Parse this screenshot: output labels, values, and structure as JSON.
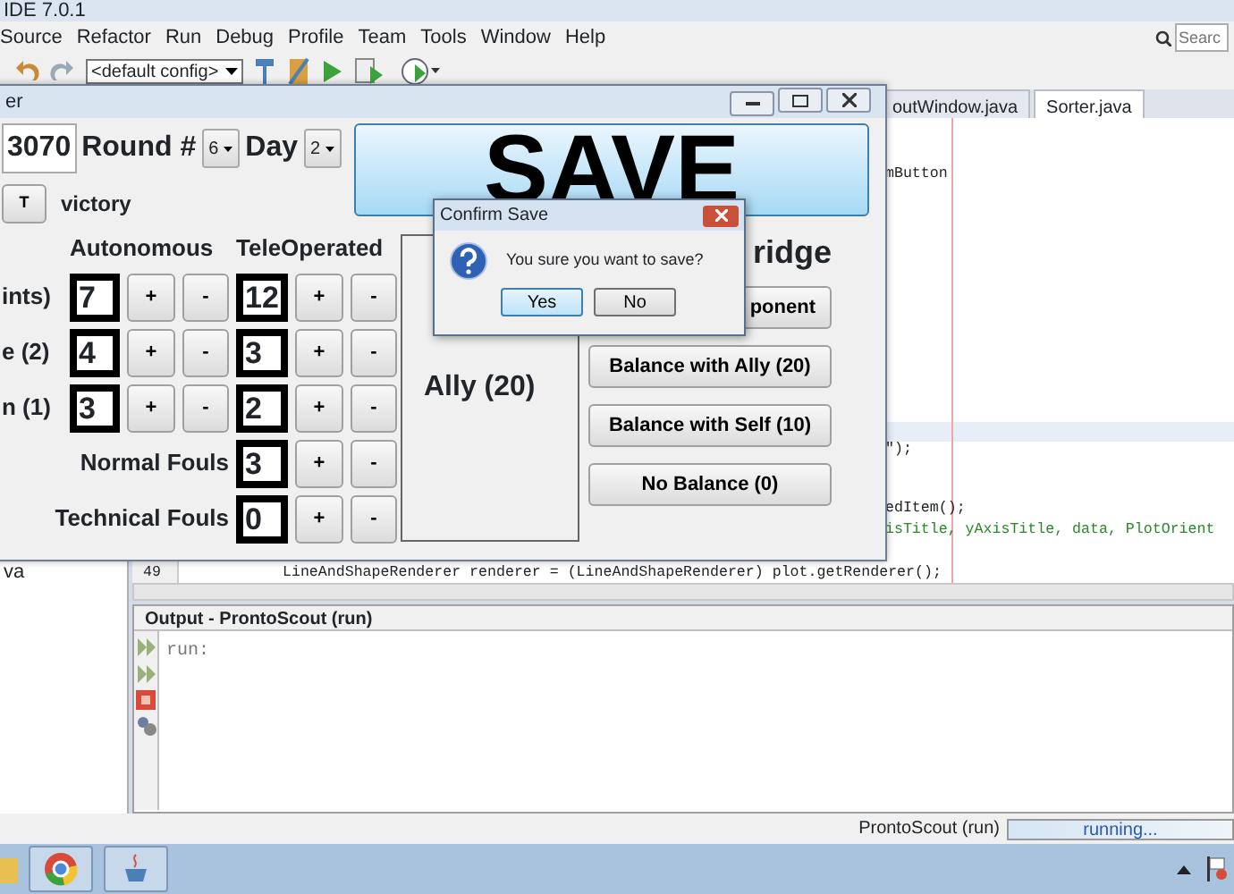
{
  "ide": {
    "title": "IDE 7.0.1",
    "menu": [
      "Source",
      "Refactor",
      "Run",
      "Debug",
      "Profile",
      "Team",
      "Tools",
      "Window",
      "Help"
    ],
    "search": {
      "placeholder": "Searc"
    },
    "config": "<default config>",
    "tabs": [
      {
        "label": "outWindow.java",
        "selected": false
      },
      {
        "label": "Sorter.java",
        "selected": true
      }
    ],
    "code_fragments": [
      {
        "kind": "plain",
        "text": "mButton"
      },
      {
        "kind": "plain",
        "text": "\");"
      },
      {
        "kind": "plain",
        "text": "edItem();"
      },
      {
        "kind": "args",
        "text": "isTitle, yAxisTitle, data, PlotOrient"
      }
    ],
    "code_line": {
      "number": "49",
      "text": "LineAndShapeRenderer renderer = (LineAndShapeRenderer) plot.getRenderer();"
    },
    "sidebar_items": [
      "va"
    ],
    "output": {
      "title": "Output - ProntoScout (run)",
      "text": "run:"
    },
    "status": {
      "task": "ProntoScout (run)",
      "progress": "running...",
      "level": 1
    }
  },
  "scout": {
    "title": "er",
    "team": "3070",
    "round_label": "Round #",
    "round": "6",
    "day_label": "Day",
    "day": "2",
    "save": "SAVE",
    "toggle": "T",
    "result": "victory",
    "columns": [
      "Autonomous",
      "TeleOperated"
    ],
    "plus": "+",
    "minus": "-",
    "rows": [
      {
        "label": "ints)",
        "auto": "7",
        "tele": "12"
      },
      {
        "label": "e (2)",
        "auto": "4",
        "tele": "3"
      },
      {
        "label": "n (1)",
        "auto": "3",
        "tele": "2"
      }
    ],
    "fouls": [
      {
        "label": "Normal Fouls",
        "value": "3"
      },
      {
        "label": "Technical Fouls",
        "value": "0"
      }
    ],
    "ally": "Ally (20)",
    "bridge_title": "ridge",
    "bridge_buttons": [
      "ponent",
      "Balance with Ally (20)",
      "Balance with Self (10)",
      "No Balance (0)"
    ]
  },
  "dialog": {
    "title": "Confirm Save",
    "message": "You sure you want to save?",
    "buttons": [
      {
        "label": "Yes",
        "selected": true
      },
      {
        "label": "No",
        "selected": false
      }
    ]
  }
}
